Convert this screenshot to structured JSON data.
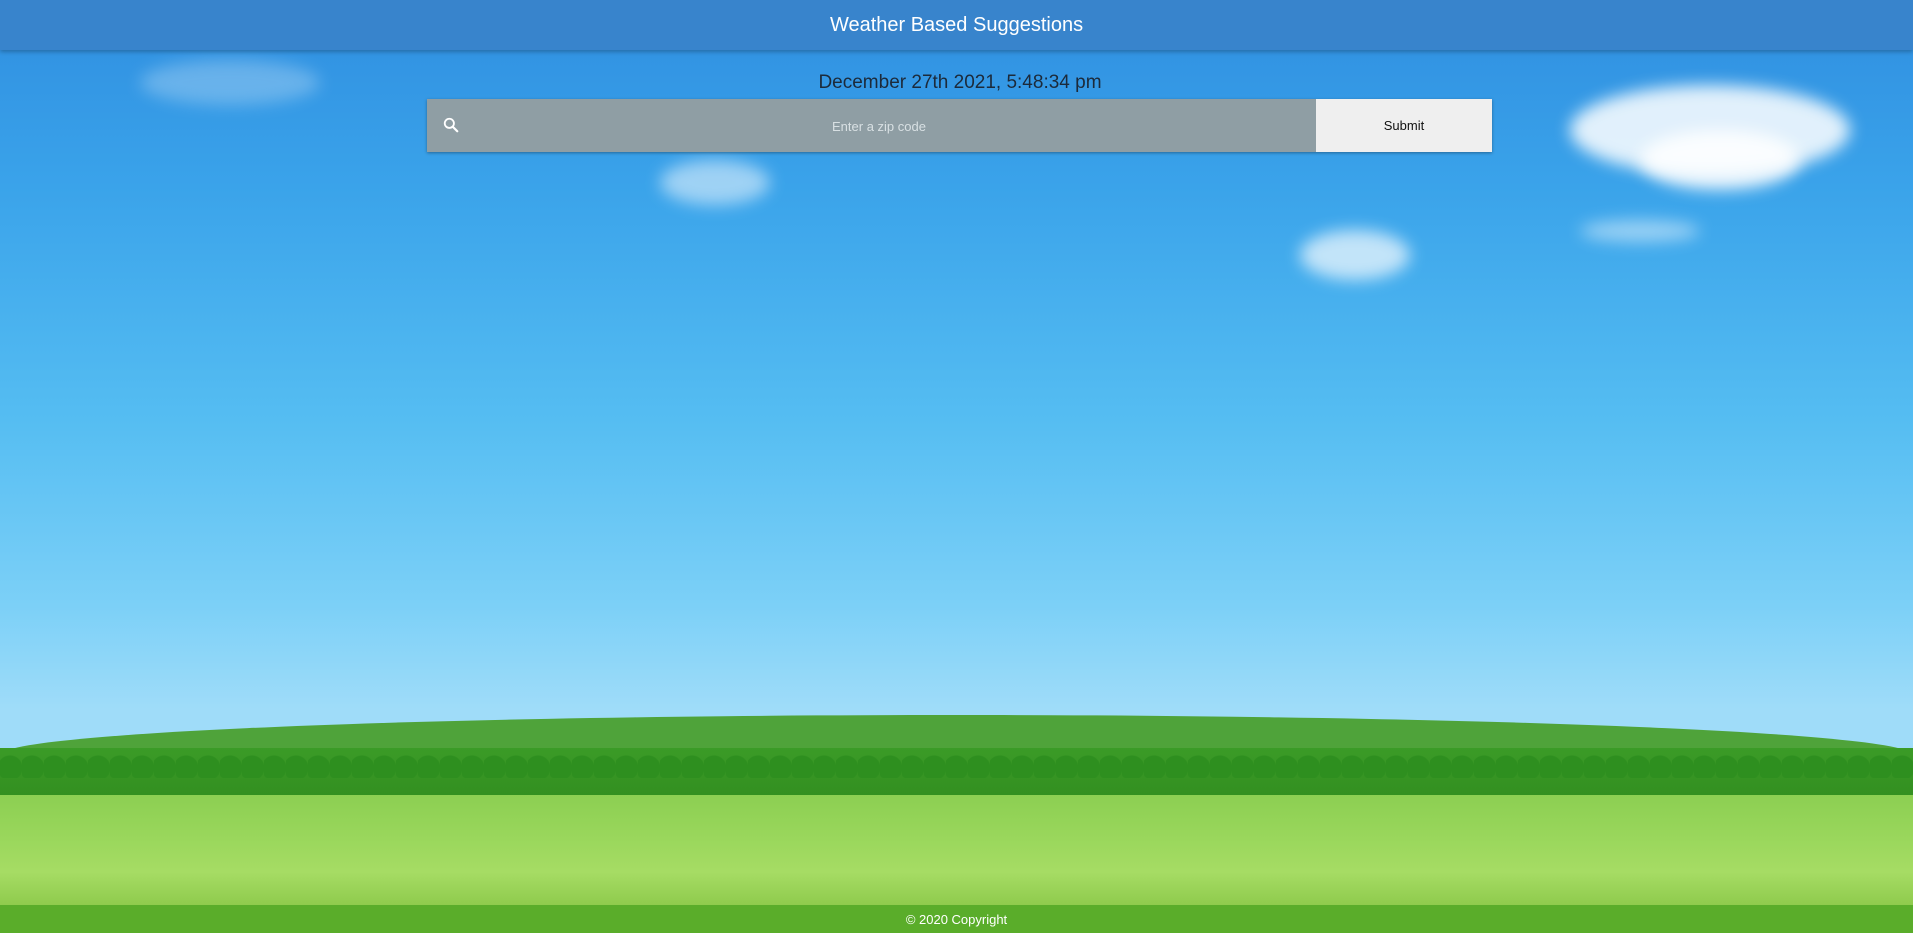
{
  "header": {
    "title": "Weather Based Suggestions"
  },
  "datetime": {
    "text": "December 27th 2021, 5:48:34 pm"
  },
  "search": {
    "icon": "search-icon",
    "placeholder": "Enter a zip code",
    "value": "",
    "submit_label": "Submit"
  },
  "footer": {
    "copyright": "© 2020 Copyright"
  },
  "colors": {
    "header_bg": "#3884cc",
    "footer_bg": "#5aad2a",
    "search_bg": "#8f9ea4",
    "submit_bg": "#efefef"
  }
}
